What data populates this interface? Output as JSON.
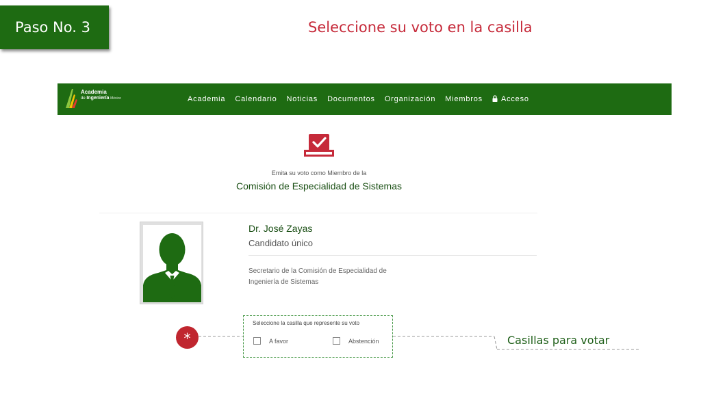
{
  "tutorial": {
    "step_label": "Paso No. 3",
    "instruction": "Seleccione su voto en la casilla",
    "marker": "*",
    "callout": "Casillas para votar"
  },
  "colors": {
    "brand_green": "#1e6b12",
    "title_red": "#c62a3a",
    "marker_red": "#c0262f",
    "dark_green_text": "#1a4f14"
  },
  "navbar": {
    "logo": {
      "line1": "Academia",
      "line2_prefix": "de",
      "line2_strong": "Ingeniería",
      "line2_suffix": "México"
    },
    "links": [
      "Academia",
      "Calendario",
      "Noticias",
      "Documentos",
      "Organización",
      "Miembros",
      "Acceso"
    ],
    "icons": {
      "access": "lock-icon"
    }
  },
  "vote": {
    "icon": "ballot-box-check-icon",
    "subtitle": "Emita su voto como Miembro de la",
    "title": "Comisión de Especialidad de Sistemas"
  },
  "candidate": {
    "photo": "person-silhouette-icon",
    "name": "Dr. José Zayas",
    "role": "Candidato único",
    "description": "Secretario de la Comisión de Especialidad de Ingeniería de Sistemas"
  },
  "ballot": {
    "prompt": "Seleccione la casilla que represente su voto",
    "options": [
      {
        "label": "A favor",
        "checked": false
      },
      {
        "label": "Abstención",
        "checked": false
      }
    ]
  }
}
